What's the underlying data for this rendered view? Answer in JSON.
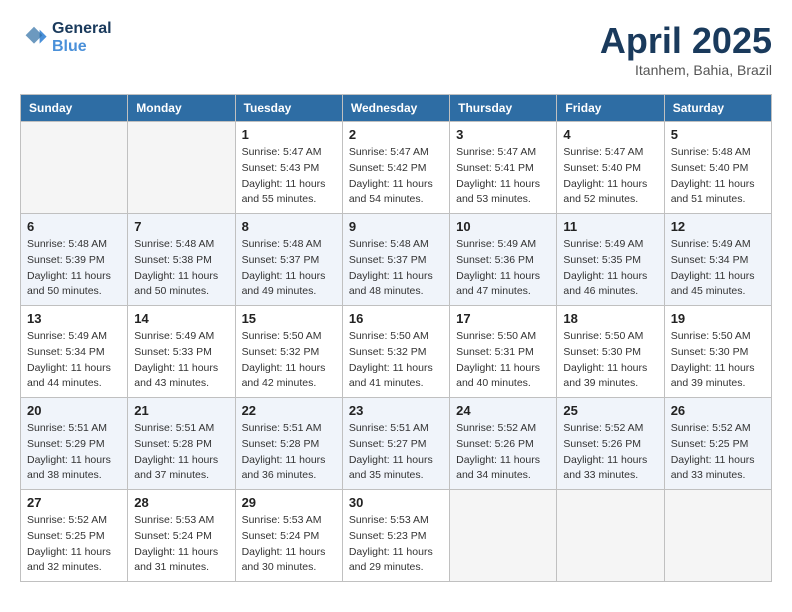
{
  "header": {
    "logo_line1": "General",
    "logo_line2": "Blue",
    "month_title": "April 2025",
    "location": "Itanhem, Bahia, Brazil"
  },
  "weekdays": [
    "Sunday",
    "Monday",
    "Tuesday",
    "Wednesday",
    "Thursday",
    "Friday",
    "Saturday"
  ],
  "weeks": [
    [
      {
        "day": "",
        "sunrise": "",
        "sunset": "",
        "daylight": ""
      },
      {
        "day": "",
        "sunrise": "",
        "sunset": "",
        "daylight": ""
      },
      {
        "day": "1",
        "sunrise": "Sunrise: 5:47 AM",
        "sunset": "Sunset: 5:43 PM",
        "daylight": "Daylight: 11 hours and 55 minutes."
      },
      {
        "day": "2",
        "sunrise": "Sunrise: 5:47 AM",
        "sunset": "Sunset: 5:42 PM",
        "daylight": "Daylight: 11 hours and 54 minutes."
      },
      {
        "day": "3",
        "sunrise": "Sunrise: 5:47 AM",
        "sunset": "Sunset: 5:41 PM",
        "daylight": "Daylight: 11 hours and 53 minutes."
      },
      {
        "day": "4",
        "sunrise": "Sunrise: 5:47 AM",
        "sunset": "Sunset: 5:40 PM",
        "daylight": "Daylight: 11 hours and 52 minutes."
      },
      {
        "day": "5",
        "sunrise": "Sunrise: 5:48 AM",
        "sunset": "Sunset: 5:40 PM",
        "daylight": "Daylight: 11 hours and 51 minutes."
      }
    ],
    [
      {
        "day": "6",
        "sunrise": "Sunrise: 5:48 AM",
        "sunset": "Sunset: 5:39 PM",
        "daylight": "Daylight: 11 hours and 50 minutes."
      },
      {
        "day": "7",
        "sunrise": "Sunrise: 5:48 AM",
        "sunset": "Sunset: 5:38 PM",
        "daylight": "Daylight: 11 hours and 50 minutes."
      },
      {
        "day": "8",
        "sunrise": "Sunrise: 5:48 AM",
        "sunset": "Sunset: 5:37 PM",
        "daylight": "Daylight: 11 hours and 49 minutes."
      },
      {
        "day": "9",
        "sunrise": "Sunrise: 5:48 AM",
        "sunset": "Sunset: 5:37 PM",
        "daylight": "Daylight: 11 hours and 48 minutes."
      },
      {
        "day": "10",
        "sunrise": "Sunrise: 5:49 AM",
        "sunset": "Sunset: 5:36 PM",
        "daylight": "Daylight: 11 hours and 47 minutes."
      },
      {
        "day": "11",
        "sunrise": "Sunrise: 5:49 AM",
        "sunset": "Sunset: 5:35 PM",
        "daylight": "Daylight: 11 hours and 46 minutes."
      },
      {
        "day": "12",
        "sunrise": "Sunrise: 5:49 AM",
        "sunset": "Sunset: 5:34 PM",
        "daylight": "Daylight: 11 hours and 45 minutes."
      }
    ],
    [
      {
        "day": "13",
        "sunrise": "Sunrise: 5:49 AM",
        "sunset": "Sunset: 5:34 PM",
        "daylight": "Daylight: 11 hours and 44 minutes."
      },
      {
        "day": "14",
        "sunrise": "Sunrise: 5:49 AM",
        "sunset": "Sunset: 5:33 PM",
        "daylight": "Daylight: 11 hours and 43 minutes."
      },
      {
        "day": "15",
        "sunrise": "Sunrise: 5:50 AM",
        "sunset": "Sunset: 5:32 PM",
        "daylight": "Daylight: 11 hours and 42 minutes."
      },
      {
        "day": "16",
        "sunrise": "Sunrise: 5:50 AM",
        "sunset": "Sunset: 5:32 PM",
        "daylight": "Daylight: 11 hours and 41 minutes."
      },
      {
        "day": "17",
        "sunrise": "Sunrise: 5:50 AM",
        "sunset": "Sunset: 5:31 PM",
        "daylight": "Daylight: 11 hours and 40 minutes."
      },
      {
        "day": "18",
        "sunrise": "Sunrise: 5:50 AM",
        "sunset": "Sunset: 5:30 PM",
        "daylight": "Daylight: 11 hours and 39 minutes."
      },
      {
        "day": "19",
        "sunrise": "Sunrise: 5:50 AM",
        "sunset": "Sunset: 5:30 PM",
        "daylight": "Daylight: 11 hours and 39 minutes."
      }
    ],
    [
      {
        "day": "20",
        "sunrise": "Sunrise: 5:51 AM",
        "sunset": "Sunset: 5:29 PM",
        "daylight": "Daylight: 11 hours and 38 minutes."
      },
      {
        "day": "21",
        "sunrise": "Sunrise: 5:51 AM",
        "sunset": "Sunset: 5:28 PM",
        "daylight": "Daylight: 11 hours and 37 minutes."
      },
      {
        "day": "22",
        "sunrise": "Sunrise: 5:51 AM",
        "sunset": "Sunset: 5:28 PM",
        "daylight": "Daylight: 11 hours and 36 minutes."
      },
      {
        "day": "23",
        "sunrise": "Sunrise: 5:51 AM",
        "sunset": "Sunset: 5:27 PM",
        "daylight": "Daylight: 11 hours and 35 minutes."
      },
      {
        "day": "24",
        "sunrise": "Sunrise: 5:52 AM",
        "sunset": "Sunset: 5:26 PM",
        "daylight": "Daylight: 11 hours and 34 minutes."
      },
      {
        "day": "25",
        "sunrise": "Sunrise: 5:52 AM",
        "sunset": "Sunset: 5:26 PM",
        "daylight": "Daylight: 11 hours and 33 minutes."
      },
      {
        "day": "26",
        "sunrise": "Sunrise: 5:52 AM",
        "sunset": "Sunset: 5:25 PM",
        "daylight": "Daylight: 11 hours and 33 minutes."
      }
    ],
    [
      {
        "day": "27",
        "sunrise": "Sunrise: 5:52 AM",
        "sunset": "Sunset: 5:25 PM",
        "daylight": "Daylight: 11 hours and 32 minutes."
      },
      {
        "day": "28",
        "sunrise": "Sunrise: 5:53 AM",
        "sunset": "Sunset: 5:24 PM",
        "daylight": "Daylight: 11 hours and 31 minutes."
      },
      {
        "day": "29",
        "sunrise": "Sunrise: 5:53 AM",
        "sunset": "Sunset: 5:24 PM",
        "daylight": "Daylight: 11 hours and 30 minutes."
      },
      {
        "day": "30",
        "sunrise": "Sunrise: 5:53 AM",
        "sunset": "Sunset: 5:23 PM",
        "daylight": "Daylight: 11 hours and 29 minutes."
      },
      {
        "day": "",
        "sunrise": "",
        "sunset": "",
        "daylight": ""
      },
      {
        "day": "",
        "sunrise": "",
        "sunset": "",
        "daylight": ""
      },
      {
        "day": "",
        "sunrise": "",
        "sunset": "",
        "daylight": ""
      }
    ]
  ]
}
